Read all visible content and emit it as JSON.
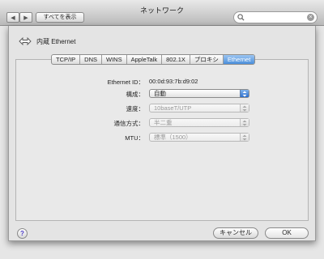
{
  "window": {
    "title": "ネットワーク",
    "show_all_label": "すべてを表示",
    "back_glyph": "◀",
    "forward_glyph": "▶"
  },
  "search": {
    "placeholder": "",
    "clear_glyph": "×"
  },
  "sheet": {
    "title": "内蔵 Ethernet",
    "tabs": [
      {
        "label": "TCP/IP",
        "active": false
      },
      {
        "label": "DNS",
        "active": false
      },
      {
        "label": "WINS",
        "active": false
      },
      {
        "label": "AppleTalk",
        "active": false
      },
      {
        "label": "802.1X",
        "active": false
      },
      {
        "label": "プロキシ",
        "active": false
      },
      {
        "label": "Ethernet",
        "active": true
      }
    ],
    "ethernet_id_label": "Ethernet ID：",
    "ethernet_id_value": "00:0d:93:7b:d9:02",
    "config_label": "構成：",
    "config_value": "自動",
    "speed_label": "速度：",
    "speed_value": "10baseT/UTP",
    "duplex_label": "通信方式：",
    "duplex_value": "半二重",
    "mtu_label": "MTU：",
    "mtu_value": "標準（1500）"
  },
  "buttons": {
    "help": "?",
    "cancel": "キャンセル",
    "ok": "OK"
  },
  "colors": {
    "accent": "#3a7fd8",
    "tab_active": "#4a8fdb"
  }
}
